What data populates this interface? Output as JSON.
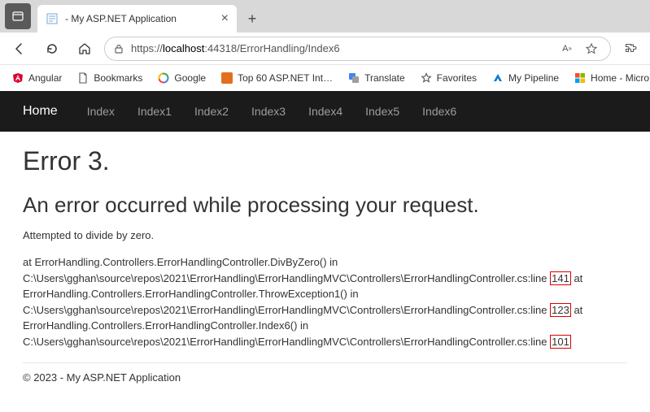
{
  "browser": {
    "tab_title": " - My ASP.NET Application",
    "url_prefix": "https://",
    "url_host": "localhost",
    "url_path": ":44318/ErrorHandling/Index6"
  },
  "bookmarks": [
    {
      "label": "Angular",
      "icon": "angular"
    },
    {
      "label": "Bookmarks",
      "icon": "file"
    },
    {
      "label": "Google",
      "icon": "google"
    },
    {
      "label": "Top 60 ASP.NET Int…",
      "icon": "dotnet"
    },
    {
      "label": "Translate",
      "icon": "gtranslate"
    },
    {
      "label": "Favorites",
      "icon": "star"
    },
    {
      "label": "My Pipeline",
      "icon": "azure"
    },
    {
      "label": "Home - Micro",
      "icon": "ms"
    }
  ],
  "nav": {
    "brand": "Home",
    "items": [
      "Index",
      "Index1",
      "Index2",
      "Index3",
      "Index4",
      "Index5",
      "Index6"
    ]
  },
  "page": {
    "title": "Error 3.",
    "heading": "An error occurred while processing your request.",
    "message": "Attempted to divide by zero.",
    "stack": {
      "pre1": "at ErrorHandling.Controllers.ErrorHandlingController.DivByZero() in C:\\Users\\gghan\\source\\repos\\2021\\ErrorHandling\\ErrorHandlingMVC\\Controllers\\ErrorHandlingController.cs:line ",
      "ln1": "141",
      "mid1": " at ErrorHandling.Controllers.ErrorHandlingController.ThrowException1() in C:\\Users\\gghan\\source\\repos\\2021\\ErrorHandling\\ErrorHandlingMVC\\Controllers\\ErrorHandlingController.cs:line ",
      "ln2": "123",
      "mid2": " at ErrorHandling.Controllers.ErrorHandlingController.Index6() in C:\\Users\\gghan\\source\\repos\\2021\\ErrorHandling\\ErrorHandlingMVC\\Controllers\\ErrorHandlingController.cs:line ",
      "ln3": "101"
    },
    "footer": "© 2023 - My ASP.NET Application"
  }
}
